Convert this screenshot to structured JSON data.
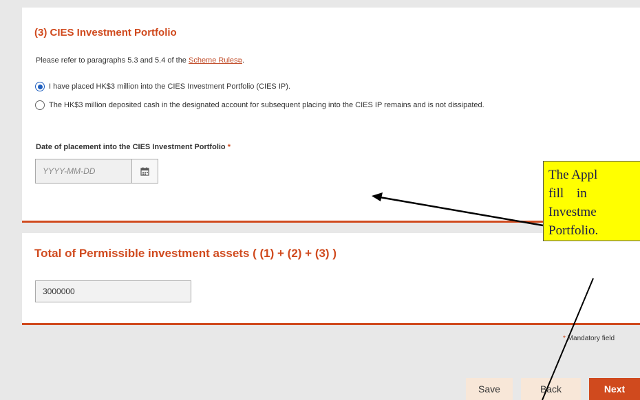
{
  "section3": {
    "title": "(3) CIES Investment Portfolio",
    "ref_prefix": "Please refer to paragraphs 5.3 and 5.4 of the ",
    "ref_link": "Scheme Rules",
    "ref_suffix": ".",
    "options": [
      {
        "label": "I have placed HK$3 million into the CIES Investment Portfolio (CIES IP).",
        "checked": true
      },
      {
        "label": "The HK$3 million deposited cash in the designated account for subsequent placing into the CIES IP remains and is not dissipated.",
        "checked": false
      }
    ],
    "date_label": "Date of placement into the CIES Investment Portfolio",
    "required_mark": "*",
    "date_placeholder": "YYYY-MM-DD"
  },
  "total": {
    "title": "Total of Permissible investment assets ( (1) + (2) + (3) )",
    "value": "3000000"
  },
  "footer": {
    "mandatory_mark": "*",
    "mandatory_text": " Mandatory field",
    "save_label": "Save",
    "back_label": "Back",
    "next_label": "Next"
  },
  "callout": {
    "lines": [
      "The Appl",
      "fill in",
      "Investme",
      "Portfolio."
    ]
  },
  "icons": {
    "calendar": "calendar-icon",
    "external_link": "external-link-icon"
  },
  "colors": {
    "accent": "#d04a1e",
    "link": "#c14d2a",
    "radio_selected": "#1f5fbf",
    "callout_bg": "#ffff00",
    "secondary_button_bg": "#f8e7d8"
  }
}
